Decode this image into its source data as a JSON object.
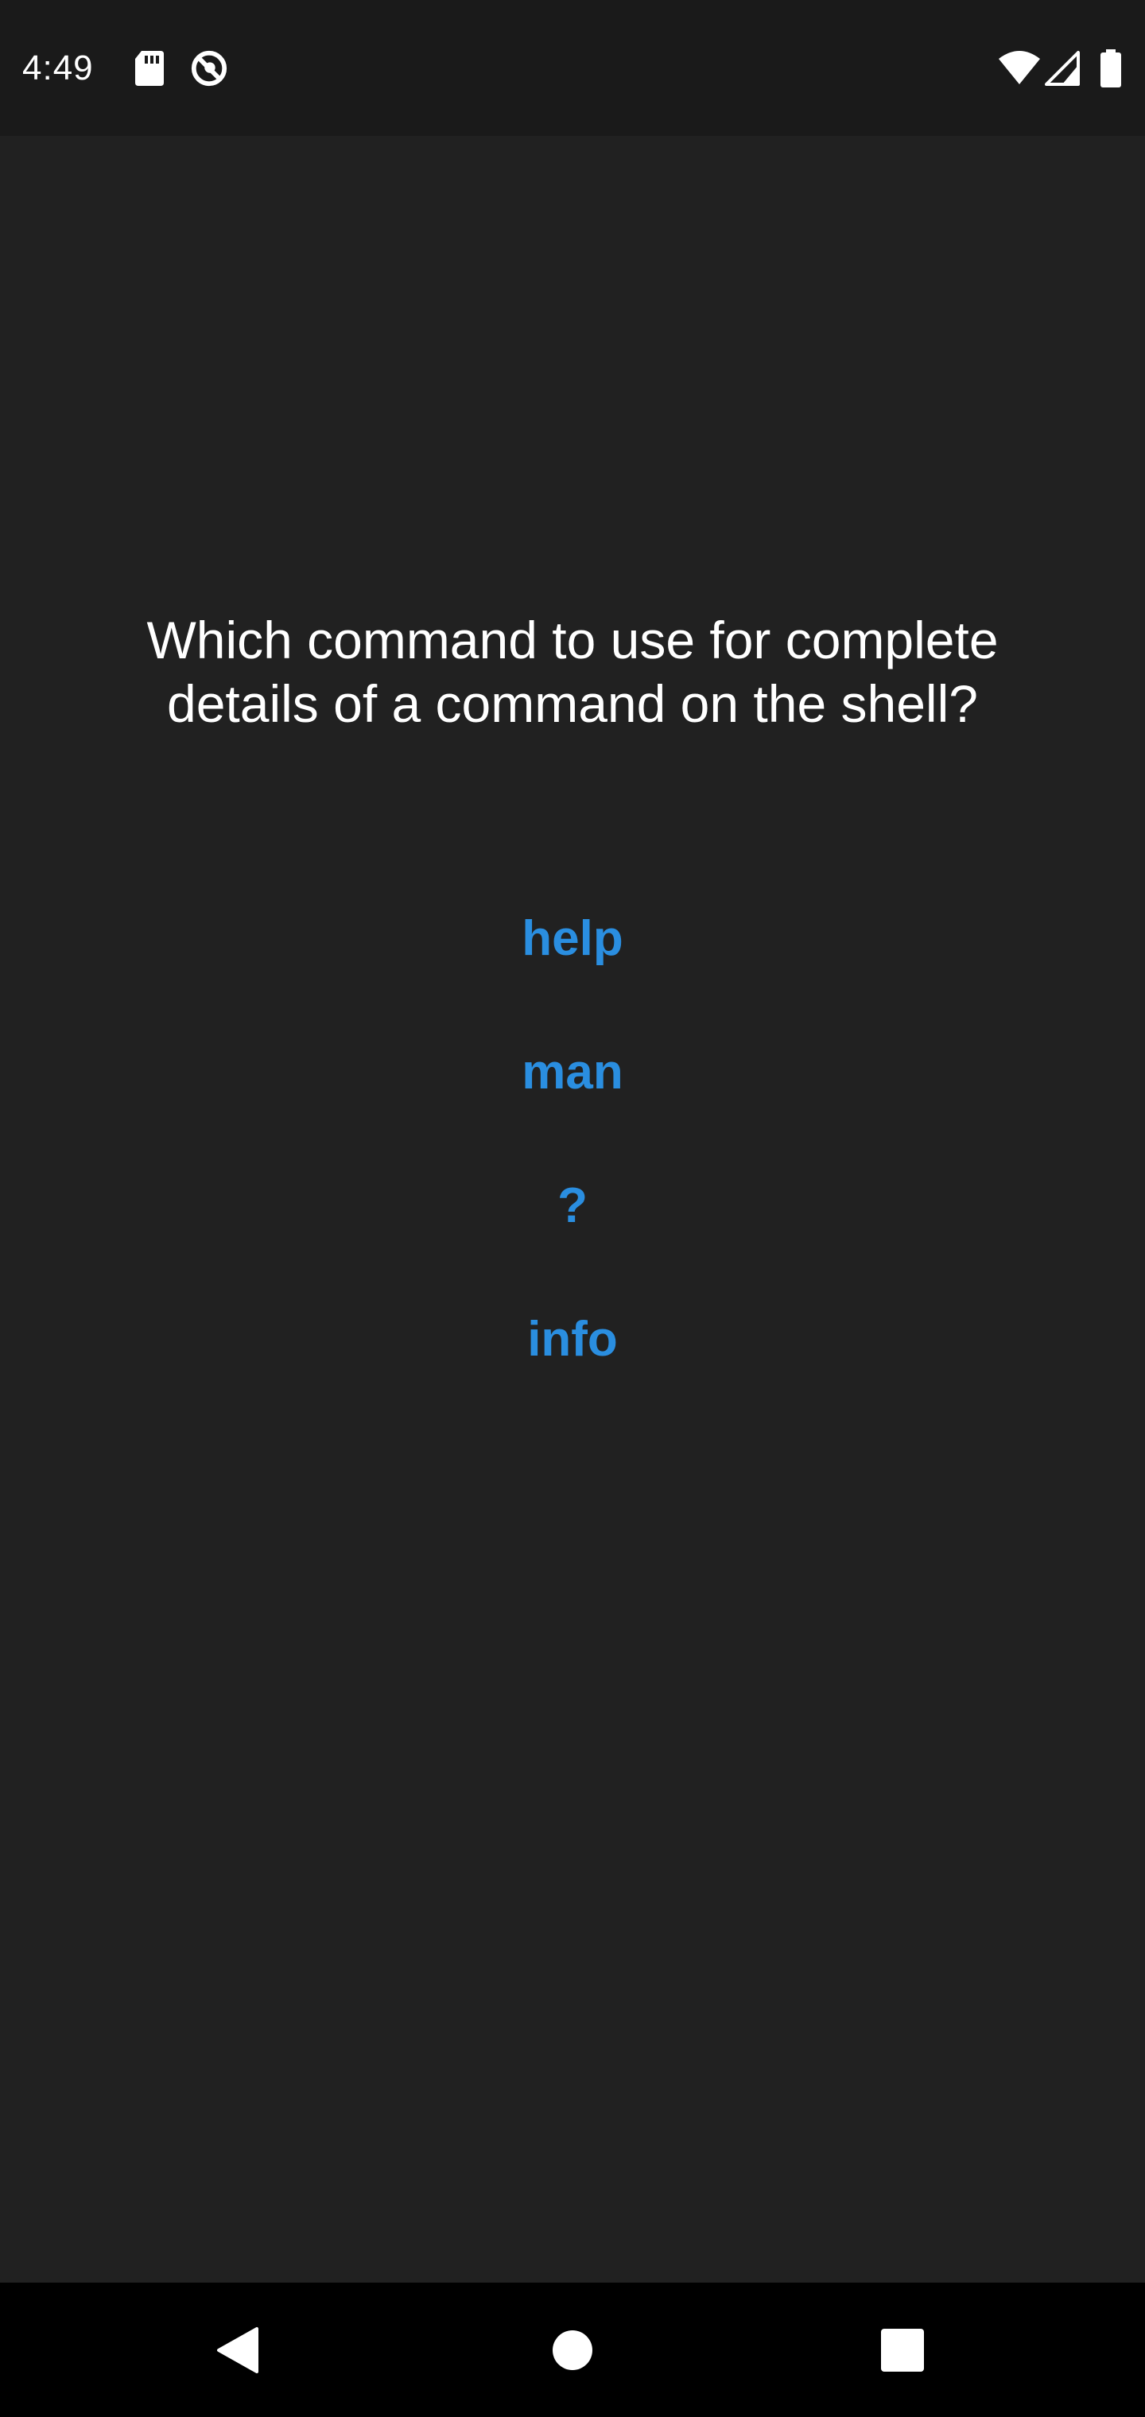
{
  "status_bar": {
    "time": "4:49",
    "icons": [
      "sd-card-icon",
      "do-not-disturb-icon",
      "wifi-icon",
      "signal-icon",
      "battery-icon"
    ]
  },
  "quiz": {
    "question": "Which command to use for complete details of a command on the shell?",
    "answers": [
      {
        "label": "help"
      },
      {
        "label": "man"
      },
      {
        "label": "?"
      },
      {
        "label": "info"
      }
    ]
  },
  "nav_bar": {
    "buttons": [
      "back-icon",
      "home-icon",
      "recents-icon"
    ]
  },
  "colors": {
    "background": "#212121",
    "status_bar": "#1a1a1a",
    "nav_bar": "#000000",
    "answer_text": "#2a8ee0",
    "question_text": "#ffffff"
  }
}
